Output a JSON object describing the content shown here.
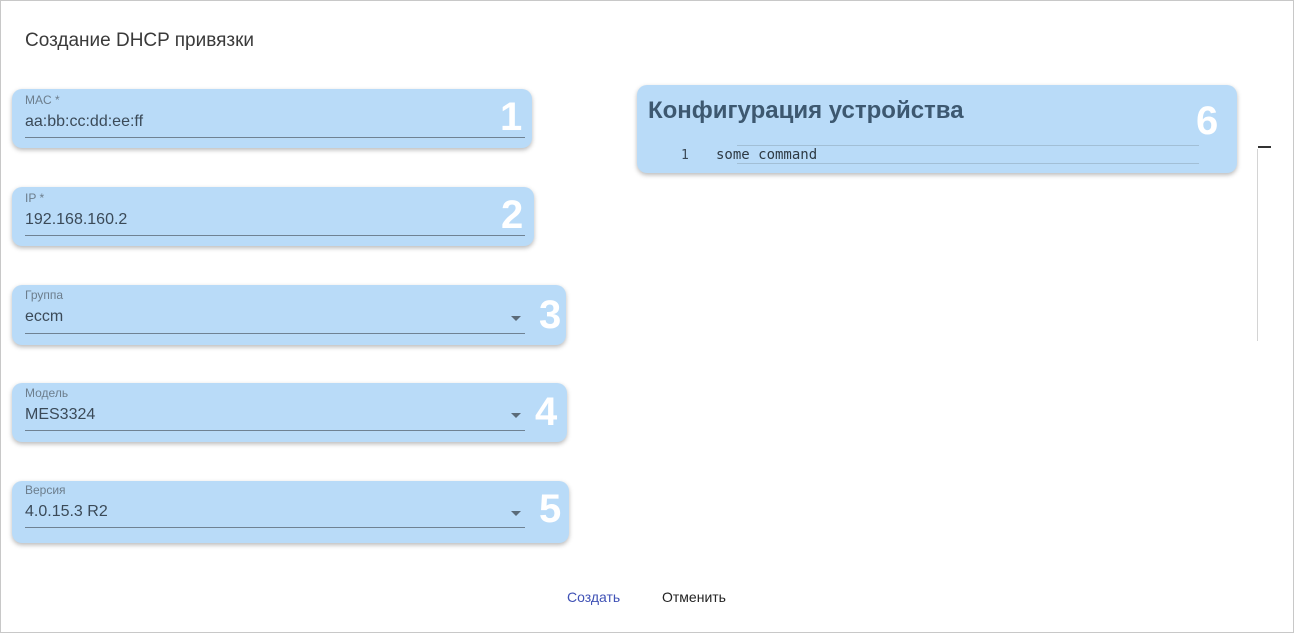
{
  "dialog": {
    "title": "Создание DHCP привязки"
  },
  "fields": [
    {
      "label": "MAC *",
      "value": "aa:bb:cc:dd:ee:ff",
      "number": "1",
      "type": "text"
    },
    {
      "label": "IP *",
      "value": "192.168.160.2",
      "number": "2",
      "type": "text"
    },
    {
      "label": "Группа",
      "value": "eccm",
      "number": "3",
      "type": "select"
    },
    {
      "label": "Модель",
      "value": "MES3324",
      "number": "4",
      "type": "select"
    },
    {
      "label": "Версия",
      "value": "4.0.15.3 R2",
      "number": "5",
      "type": "select"
    }
  ],
  "config": {
    "title": "Конфигурация устройства",
    "number": "6",
    "lines": [
      {
        "line_number": "1",
        "text": "some command"
      }
    ]
  },
  "actions": {
    "create_label": "Создать",
    "cancel_label": "Отменить"
  },
  "colors": {
    "card_background": "#b9dbf8",
    "primary_button": "#3f51b5"
  },
  "icons": {
    "dropdown": "chevron-down-icon"
  }
}
